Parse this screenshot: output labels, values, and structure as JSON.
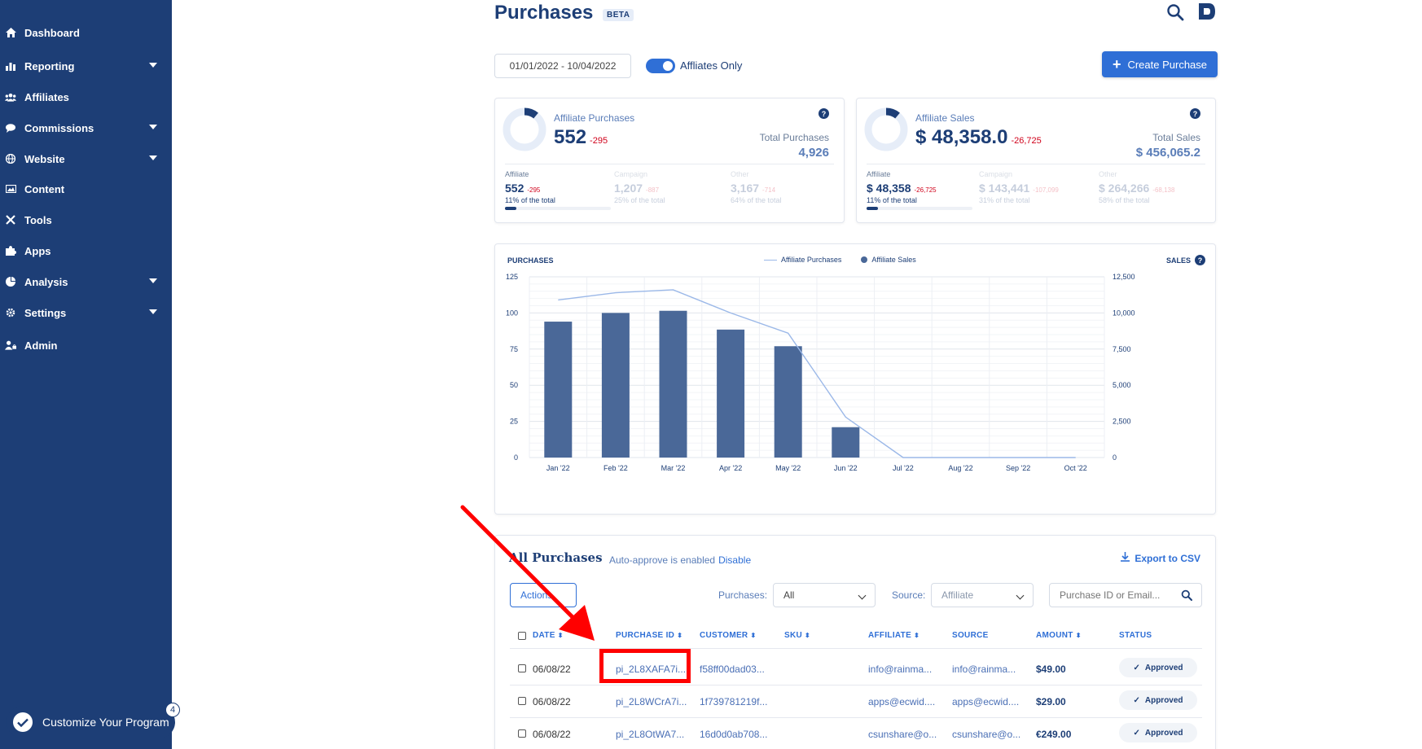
{
  "sidebar": {
    "items": [
      {
        "label": "Dashboard",
        "icon": "home-icon",
        "has_caret": false
      },
      {
        "label": "Reporting",
        "icon": "bar-chart-icon",
        "has_caret": true
      },
      {
        "label": "Affiliates",
        "icon": "users-icon",
        "has_caret": false
      },
      {
        "label": "Commissions",
        "icon": "comments-icon",
        "has_caret": true
      },
      {
        "label": "Website",
        "icon": "globe-icon",
        "has_caret": true
      },
      {
        "label": "Content",
        "icon": "image-icon",
        "has_caret": false
      },
      {
        "label": "Tools",
        "icon": "tools-icon",
        "has_caret": false
      },
      {
        "label": "Apps",
        "icon": "puzzle-icon",
        "has_caret": false
      },
      {
        "label": "Analysis",
        "icon": "pie-chart-icon",
        "has_caret": true
      },
      {
        "label": "Settings",
        "icon": "gear-icon",
        "has_caret": true
      },
      {
        "label": "Admin",
        "icon": "user-lock-icon",
        "has_caret": false
      }
    ],
    "customize_label": "Customize Your Program",
    "customize_badge": "4"
  },
  "header": {
    "title": "Purchases",
    "badge": "BETA",
    "date_range": "01/01/2022 - 10/04/2022",
    "toggle_label": "Affliates Only",
    "toggle_on": true,
    "create_button": "Create Purchase"
  },
  "stats": {
    "purchases": {
      "label": "Affiliate Purchases",
      "value": "552",
      "delta": "-295",
      "total_label": "Total Purchases",
      "total_value": "4,926",
      "donut_fraction": 0.11,
      "subs": [
        {
          "label": "Affiliate",
          "value": "552",
          "delta": "-295",
          "pct": "11% of the total",
          "fraction": 0.11
        },
        {
          "label": "Campaign",
          "value": "1,207",
          "delta": "-887",
          "pct": "25% of the total",
          "fraction": 0.25
        },
        {
          "label": "Other",
          "value": "3,167",
          "delta": "-714",
          "pct": "64% of the total",
          "fraction": 0.64
        }
      ]
    },
    "sales": {
      "label": "Affiliate Sales",
      "value": "$ 48,358.0",
      "delta": "-26,725",
      "total_label": "Total Sales",
      "total_value": "$ 456,065.2",
      "donut_fraction": 0.11,
      "subs": [
        {
          "label": "Affiliate",
          "value": "$ 48,358",
          "delta": "-26,725",
          "pct": "11% of the total",
          "fraction": 0.11
        },
        {
          "label": "Campaign",
          "value": "$ 143,441",
          "delta": "-107,099",
          "pct": "31% of the total",
          "fraction": 0.31
        },
        {
          "label": "Other",
          "value": "$ 264,266",
          "delta": "-68,138",
          "pct": "58% of the total",
          "fraction": 0.58
        }
      ]
    }
  },
  "chart_data": {
    "type": "bar",
    "categories": [
      "Jan '22",
      "Feb '22",
      "Mar '22",
      "Apr '22",
      "May '22",
      "Jun '22",
      "Jul '22",
      "Aug '22",
      "Sep '22",
      "Oct '22"
    ],
    "series": [
      {
        "name": "Affiliate Sales",
        "type": "bar",
        "axis": "right",
        "values": [
          9400,
          10000,
          10150,
          8850,
          7700,
          2100,
          0,
          0,
          0,
          0
        ]
      },
      {
        "name": "Affiliate Purchases",
        "type": "line",
        "axis": "left",
        "values": [
          109,
          114,
          116,
          100,
          86,
          28,
          0,
          0,
          0,
          0
        ]
      }
    ],
    "ylabel": "PURCHASES",
    "y2label": "SALES",
    "ylim": [
      0,
      125
    ],
    "y2lim": [
      0,
      12500
    ],
    "yticks": [
      "0",
      "25",
      "50",
      "75",
      "100",
      "125"
    ],
    "y2ticks": [
      "0",
      "2,500",
      "5,000",
      "7,500",
      "10,000",
      "12,500"
    ],
    "grid": true,
    "legend": "top-center"
  },
  "table": {
    "title": "All Purchases",
    "auto_text": "Auto-approve is enabled",
    "disable_label": "Disable",
    "export_label": "Export to CSV",
    "actions_label": "Actions",
    "purchases_filter_label": "Purchases:",
    "purchases_filter_value": "All",
    "source_filter_label": "Source:",
    "source_filter_value": "Affiliate",
    "search_placeholder": "Purchase ID or Email...",
    "columns": [
      "DATE",
      "PURCHASE ID",
      "CUSTOMER",
      "SKU",
      "AFFILIATE",
      "SOURCE",
      "AMOUNT",
      "STATUS"
    ],
    "rows": [
      {
        "date": "06/08/22",
        "purchase_id": "pi_2L8XAFA7i...",
        "customer": "f58ff00dad03...",
        "sku": "",
        "affiliate": "info@rainma...",
        "source": "info@rainma...",
        "amount": "$49.00",
        "status": "Approved"
      },
      {
        "date": "06/08/22",
        "purchase_id": "pi_2L8WCrA7i...",
        "customer": "1f739781219f...",
        "sku": "",
        "affiliate": "apps@ecwid....",
        "source": "apps@ecwid....",
        "amount": "$29.00",
        "status": "Approved"
      },
      {
        "date": "06/08/22",
        "purchase_id": "pi_2L8OtWA7...",
        "customer": "16d0d0ab708...",
        "sku": "",
        "affiliate": "csunshare@o...",
        "source": "csunshare@o...",
        "amount": "€249.00",
        "status": "Approved"
      }
    ]
  },
  "colors": {
    "sidebar": "#1d3e76",
    "accent": "#2f6fd6",
    "bar": "#4a6898",
    "line": "#9bb8e8",
    "annotation": "#ff0000"
  }
}
